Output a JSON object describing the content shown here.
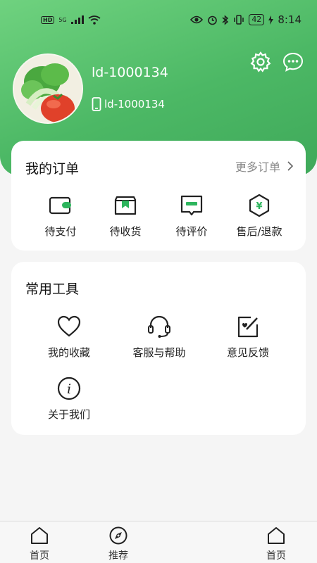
{
  "status_bar": {
    "network_badge": "HD",
    "signal_label": "5G",
    "battery": "42",
    "time": "8:14"
  },
  "profile": {
    "username": "ld-1000134",
    "phone": "ld-1000134"
  },
  "orders": {
    "title": "我的订单",
    "more_label": "更多订单",
    "items": [
      {
        "label": "待支付",
        "icon": "wallet-icon"
      },
      {
        "label": "待收货",
        "icon": "package-icon"
      },
      {
        "label": "待评价",
        "icon": "review-icon"
      },
      {
        "label": "售后/退款",
        "icon": "refund-icon"
      }
    ]
  },
  "tools": {
    "title": "常用工具",
    "items": [
      {
        "label": "我的收藏",
        "icon": "heart-icon"
      },
      {
        "label": "客服与帮助",
        "icon": "headset-icon"
      },
      {
        "label": "意见反馈",
        "icon": "feedback-icon"
      },
      {
        "label": "关于我们",
        "icon": "info-icon"
      }
    ]
  },
  "tabbar": {
    "items": [
      {
        "label": "首页",
        "icon": "home-icon"
      },
      {
        "label": "推荐",
        "icon": "compass-icon"
      },
      {
        "label": "首页",
        "icon": "home-icon"
      }
    ]
  },
  "colors": {
    "brand_green": "#4cb865",
    "icon_green": "#2db55d"
  }
}
